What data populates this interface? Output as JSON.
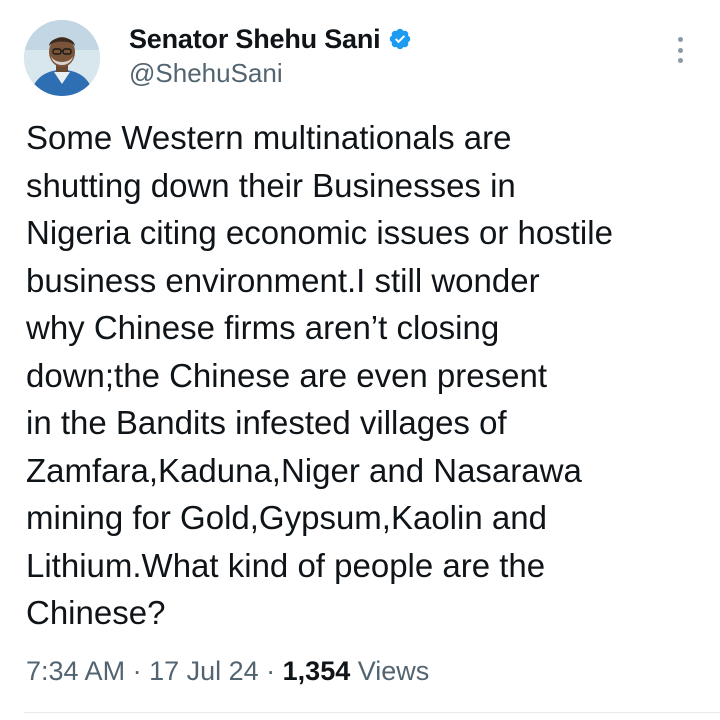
{
  "author": {
    "display_name": "Senator Shehu Sani",
    "handle": "@ShehuSani",
    "verified_icon": "verified-badge-icon",
    "avatar_icon": "avatar-photo"
  },
  "tweet": {
    "lines": [
      "Some Western multinationals are",
      "shutting down their Businesses in",
      "Nigeria citing economic issues or hostile",
      "business environment.I still wonder",
      "why Chinese firms aren’t closing",
      "down;the Chinese are even present",
      "in the Bandits infested villages of",
      "Zamfara,Kaduna,Niger and Nasarawa",
      "mining for Gold,Gypsum,Kaolin and",
      "Lithium.What kind of people are the",
      "Chinese?"
    ]
  },
  "meta": {
    "time": "7:34 AM",
    "sep1": " · ",
    "date": "17 Jul 24",
    "sep2": " · ",
    "views_count": "1,354",
    "views_label": " Views"
  },
  "colors": {
    "verified_blue": "#1d9bf0",
    "text_primary": "#0f1419",
    "text_secondary": "#536471"
  },
  "more_icon": "more-vertical-icon"
}
